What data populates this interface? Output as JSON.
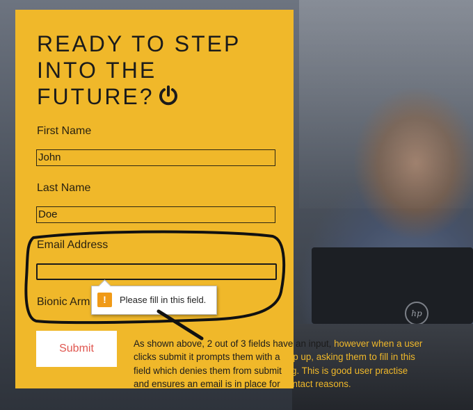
{
  "form": {
    "heading": "READY TO STEP INTO THE FUTURE?",
    "heading_icon": "power-icon",
    "fields": [
      {
        "label": "First Name",
        "value": "John"
      },
      {
        "label": "Last Name",
        "value": "Doe"
      },
      {
        "label": "Email Address",
        "value": ""
      },
      {
        "label": "Bionic Arm",
        "value": ""
      }
    ],
    "submit_label": "Submit",
    "validation_tooltip": "Please fill in this field.",
    "tooltip_icon": "warning-icon"
  },
  "annotation": {
    "line1_dark": "As shown above, 2 out of 3 fields have an input,",
    "line1_light": " however when a user",
    "line2_dark": "clicks submit it prompts them with a",
    "line2_light": " pop up, asking them to fill in this",
    "line3_dark": "field which denies them from submit",
    "line3_light": "ting. This is good user practise",
    "line4_dark": "and ensures an email is in place for",
    "line4_light": " contact reasons."
  },
  "colors": {
    "panel": "#f0b82a",
    "submit_text": "#e0564f",
    "warning": "#f09a17"
  }
}
